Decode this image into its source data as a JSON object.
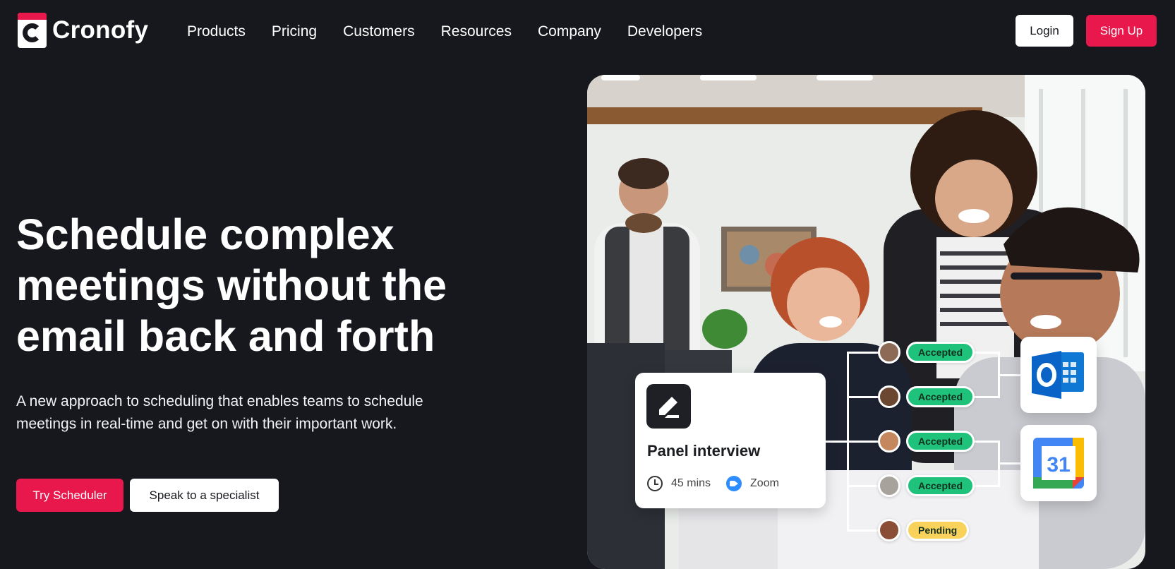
{
  "brand": {
    "name": "Cronofy"
  },
  "nav": {
    "items": [
      "Products",
      "Pricing",
      "Customers",
      "Resources",
      "Company",
      "Developers"
    ]
  },
  "auth": {
    "login": "Login",
    "signup": "Sign Up"
  },
  "hero": {
    "title_lines": [
      "Schedule complex",
      "meetings without the",
      "email back and forth"
    ],
    "subtitle_lines": [
      "A new approach to scheduling that enables teams to schedule",
      "meetings in real-time and get on with their important work."
    ],
    "cta_primary": "Try Scheduler",
    "cta_secondary": "Speak to a specialist"
  },
  "overlay": {
    "event": {
      "title": "Panel interview",
      "duration": "45 mins",
      "location": "Zoom",
      "icon": "pencil-icon"
    },
    "attendees": [
      {
        "status": "Accepted",
        "color": "#1fc27a"
      },
      {
        "status": "Accepted",
        "color": "#1fc27a"
      },
      {
        "status": "Accepted",
        "color": "#1fc27a"
      },
      {
        "status": "Accepted",
        "color": "#1fc27a"
      },
      {
        "status": "Pending",
        "color": "#f9d25b"
      }
    ],
    "calendars": [
      {
        "name": "Outlook",
        "icon": "outlook-calendar-icon",
        "color": "#0a64c8"
      },
      {
        "name": "Google Calendar",
        "icon": "google-calendar-icon",
        "day": "31",
        "color": "#4285f4"
      }
    ]
  },
  "colors": {
    "accent": "#e8174c",
    "background": "#16181e"
  }
}
